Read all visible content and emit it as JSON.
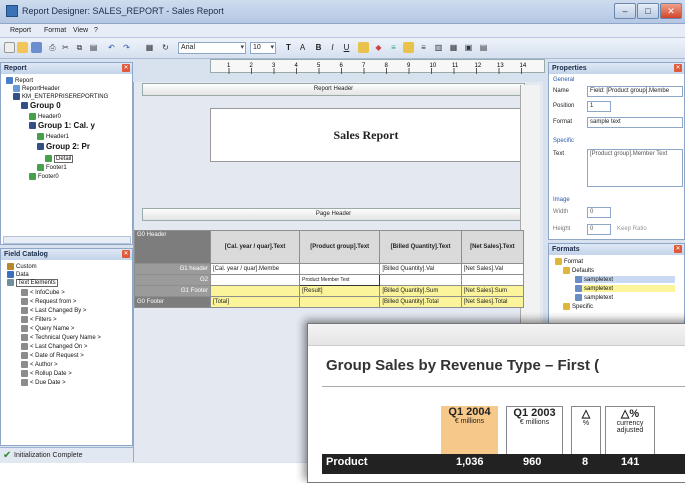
{
  "window": {
    "title": "Report Designer: SALES_REPORT - Sales Report"
  },
  "menu": [
    "Report",
    "Format",
    "View",
    "?"
  ],
  "toolbar": {
    "font": "Arial",
    "size": "10",
    "ruler_ticks": [
      "1",
      "2",
      "3",
      "4",
      "5",
      "6",
      "7",
      "8",
      "9",
      "10",
      "11",
      "12",
      "13",
      "14"
    ]
  },
  "report_panel": {
    "title": "Report",
    "items": [
      "Report",
      "ReportHeader",
      "KM_ENTERPRISEREPORTING",
      "Group 0",
      "Header0",
      "Group 1: Cal. y",
      "Header1",
      "Group 2: Pr",
      "Detail",
      "Footer1",
      "Footer0"
    ]
  },
  "field_catalog": {
    "title": "Field Catalog",
    "items": [
      "Custom",
      "Data",
      "Text Elements",
      "< InfoCube >",
      "< Request from >",
      "< Last Changed By >",
      "< Filters >",
      "< Query Name >",
      "< Technical Query Name >",
      "< Last Changed On >",
      "< Date of Request >",
      "< Author >",
      "< Rollup Date >",
      "< Due Date >"
    ]
  },
  "design": {
    "report_header": "Report Header",
    "title": "Sales Report",
    "page_header": "Page Header",
    "group_header": "G0 Header",
    "g1_header": "G1 header",
    "g2": "G2",
    "g1_footer": "G1 Footer",
    "g0_footer": "G0 Footer",
    "columns": [
      "[Cal. year / quar].Text",
      "[Product group].Text",
      "[Billed Quantity].Text",
      "[Net Sales].Text"
    ],
    "row1": [
      "[Cal. year / quar].Membe",
      "",
      "[Billed Quantity].Val",
      "[Net Sales].Val"
    ],
    "row2": [
      "",
      "Product Member Text",
      "",
      ""
    ],
    "row3": [
      "",
      "[Result]",
      "[Billed Quantity].Sum",
      "[Net Sales].Sum"
    ],
    "row4": [
      "[Total]",
      "",
      "[Billed Quantity].Total",
      "[Net Sales].Total"
    ]
  },
  "properties": {
    "title": "Properties",
    "general": "General",
    "name_label": "Name",
    "name_value": "Field: [Product group].Membe",
    "position_label": "Position",
    "position_value": "1",
    "format_label": "Format",
    "format_value": "sample text",
    "specific": "Specific",
    "text_label": "Text",
    "text_value": "[Product group].Member Text",
    "image": "Image",
    "width_label": "Width",
    "width_value": "0",
    "height_label": "Height",
    "height_value": "0",
    "keep_ratio": "Keep Ratio"
  },
  "formats": {
    "title": "Formats",
    "items": [
      "Format",
      "Defaults",
      "sampletext",
      "sampletext",
      "sampletext",
      "Specific"
    ]
  },
  "status": {
    "text": "Initialization Complete"
  },
  "overlay": {
    "heading": "Group Sales by Revenue Type – First (",
    "col1": "Q1 2004",
    "col1_sub": "€ millions",
    "col2": "Q1 2003",
    "col2_sub": "€ millions",
    "col3": "△",
    "col3_sub": "%",
    "col4": "△%",
    "col4_sub": "currency adjusted",
    "row_label": "Product",
    "row_v1": "1,036",
    "row_v2": "960",
    "row_v3": "8",
    "row_v4": "141"
  }
}
